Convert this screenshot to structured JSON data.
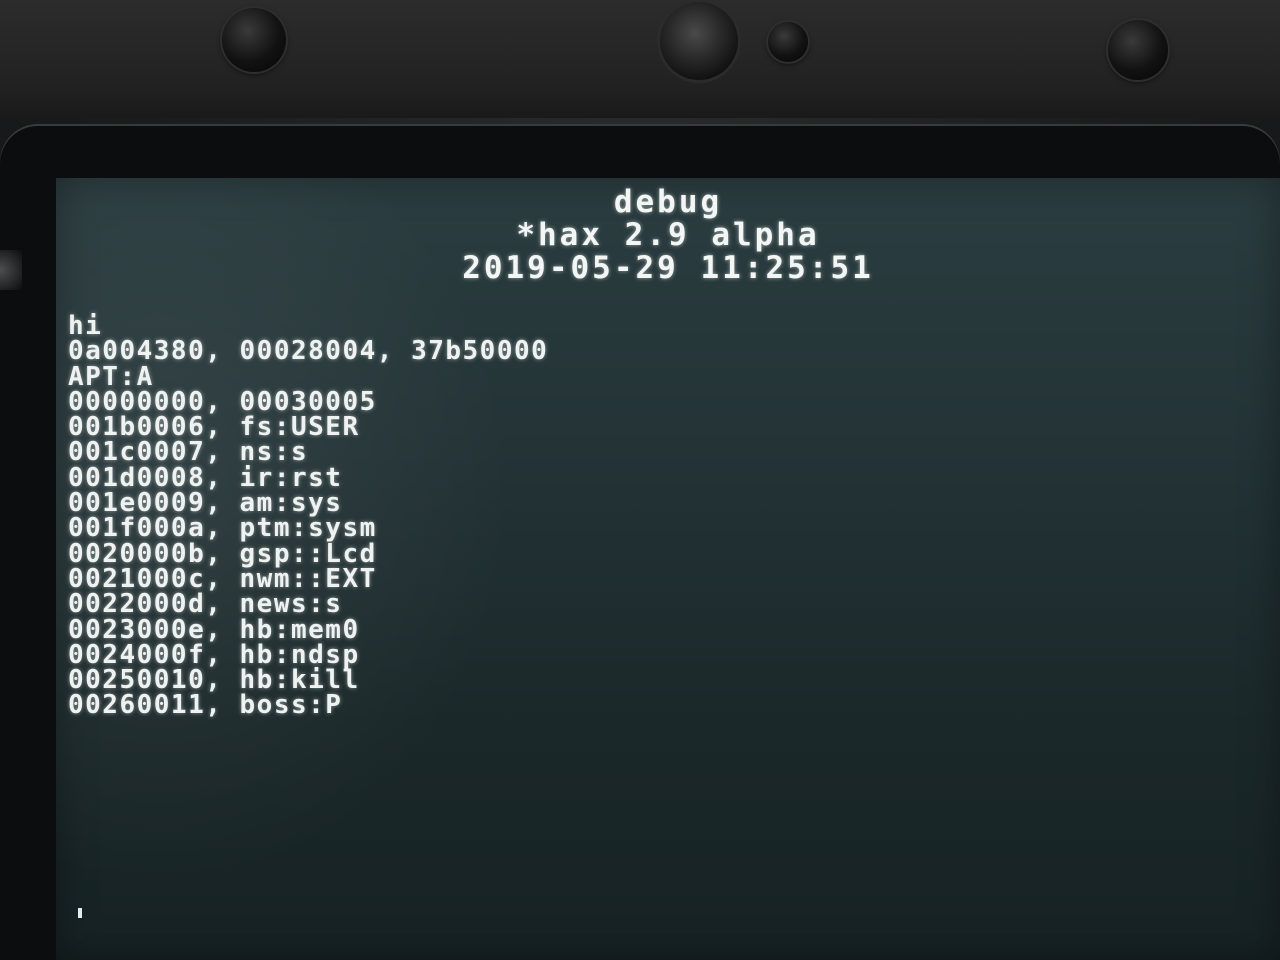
{
  "header": {
    "title": "debug",
    "subtitle": "*hax 2.9 alpha",
    "timestamp": "2019-05-29 11:25:51"
  },
  "console": {
    "lines": [
      "hi",
      "0a004380, 00028004, 37b50000",
      "APT:A",
      "00000000, 00030005",
      "001b0006, fs:USER",
      "001c0007, ns:s",
      "001d0008, ir:rst",
      "001e0009, am:sys",
      "001f000a, ptm:sysm",
      "0020000b, gsp::Lcd",
      "0021000c, nwm::EXT",
      "0022000d, news:s",
      "0023000e, hb:mem0",
      "0024000f, hb:ndsp",
      "00250010, hb:kill",
      "00260011, boss:P"
    ]
  },
  "colors": {
    "screen_background": "#233336",
    "text": "#eef3f1",
    "bezel": "#0c0d0e"
  }
}
